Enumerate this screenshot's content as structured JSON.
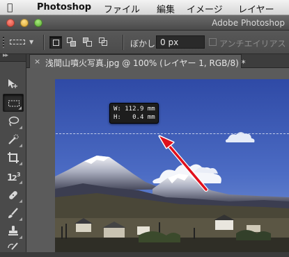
{
  "menubar": {
    "apple_icon": "apple-icon",
    "items": [
      "Photoshop",
      "ファイル",
      "編集",
      "イメージ",
      "レイヤー"
    ]
  },
  "window": {
    "title": "Adobe Photoshop"
  },
  "options": {
    "feather_label": "ぼかし :",
    "feather_value": "0 px",
    "antialias_label": "アンチエイリアス",
    "antialias_checked": false
  },
  "document": {
    "close_icon": "×",
    "tab_title": "浅間山噴火写真.jpg @ 100% (レイヤー 1, RGB/8) *"
  },
  "measure_tip": {
    "w_label": "W:",
    "w_value": "112.9 mm",
    "h_label": "H:",
    "h_value": "0.4 mm"
  },
  "colors": {
    "accent_arrow": "#e0101c",
    "sky_top": "#2f4aa6",
    "sky_bottom": "#6f8fd6"
  }
}
